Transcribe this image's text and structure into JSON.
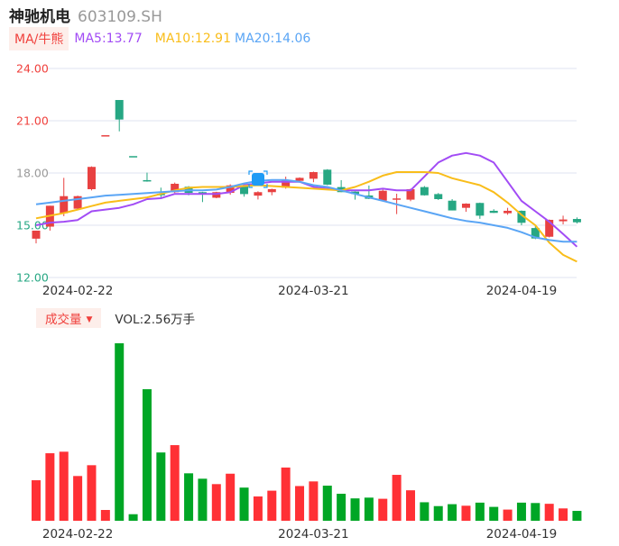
{
  "header": {
    "stock_name": "神驰机电",
    "stock_code": "603109.SH"
  },
  "ma_legend": {
    "toggle_label": "MA/牛熊",
    "ma5": "MA5:13.77",
    "ma10": "MA10:12.91",
    "ma20": "MA20:14.06"
  },
  "volume_legend": {
    "toggle_label": "成交量",
    "value": "VOL:2.56万手"
  },
  "colors": {
    "up": "#e84141",
    "down": "#26a783",
    "vol_up": "#ff3035",
    "vol_down": "#00a625",
    "ma5": "#a24cf5",
    "ma10": "#f9bd1a",
    "ma20": "#5aa5f5",
    "grid": "#dfe3f0"
  },
  "chart_data": [
    {
      "type": "candlestick",
      "title": "神驰机电 603109.SH",
      "ylim": [
        12,
        24
      ],
      "y_ticks": [
        {
          "label": "24.00",
          "value": 24,
          "color": "#f0403c"
        },
        {
          "label": "21.00",
          "value": 21,
          "color": "#f0403c"
        },
        {
          "label": "18.00",
          "value": 18,
          "color": "#999999"
        },
        {
          "label": "15.00",
          "value": 15,
          "color": "#26a783"
        },
        {
          "label": "12.00",
          "value": 12,
          "color": "#26a783"
        }
      ],
      "x_ticks": [
        {
          "label": "2024-02-22",
          "index": 3
        },
        {
          "label": "2024-03-21",
          "index": 20
        },
        {
          "label": "2024-04-19",
          "index": 35
        }
      ],
      "grid": true,
      "ohlc": [
        [
          14.23,
          14.69,
          13.96,
          14.69
        ],
        [
          14.92,
          16.12,
          14.69,
          16.12
        ],
        [
          15.69,
          17.72,
          15.52,
          16.67
        ],
        [
          15.95,
          16.7,
          15.9,
          16.67
        ],
        [
          17.07,
          18.38,
          17.0,
          18.35
        ],
        [
          20.17,
          20.17,
          20.17,
          20.17
        ],
        [
          22.19,
          22.19,
          20.39,
          21.07
        ],
        [
          18.97,
          18.97,
          18.97,
          18.97
        ],
        [
          17.59,
          18.02,
          17.5,
          17.52
        ],
        [
          16.8,
          17.16,
          16.59,
          16.72
        ],
        [
          16.9,
          17.45,
          16.85,
          17.38
        ],
        [
          17.21,
          17.25,
          16.72,
          16.86
        ],
        [
          16.9,
          16.92,
          16.33,
          16.8
        ],
        [
          16.58,
          16.92,
          16.55,
          16.9
        ],
        [
          16.86,
          17.35,
          16.75,
          17.29
        ],
        [
          17.28,
          17.3,
          16.64,
          16.79
        ],
        [
          16.7,
          16.95,
          16.48,
          16.9
        ],
        [
          16.9,
          17.1,
          16.72,
          17.07
        ],
        [
          17.16,
          17.79,
          17.1,
          17.59
        ],
        [
          17.55,
          17.75,
          17.5,
          17.72
        ],
        [
          17.67,
          18.08,
          17.47,
          18.05
        ],
        [
          18.19,
          18.22,
          17.3,
          17.33
        ],
        [
          17.19,
          17.59,
          16.9,
          16.9
        ],
        [
          16.93,
          16.95,
          16.47,
          16.8
        ],
        [
          16.71,
          17.28,
          16.5,
          16.52
        ],
        [
          16.41,
          17.1,
          16.4,
          16.98
        ],
        [
          16.54,
          16.81,
          15.64,
          16.54
        ],
        [
          16.47,
          17.1,
          16.38,
          17.07
        ],
        [
          17.19,
          17.25,
          16.7,
          16.72
        ],
        [
          16.79,
          16.85,
          16.45,
          16.5
        ],
        [
          16.41,
          16.5,
          15.85,
          15.85
        ],
        [
          16.0,
          16.26,
          15.77,
          16.24
        ],
        [
          16.28,
          16.3,
          15.37,
          15.55
        ],
        [
          15.83,
          15.92,
          15.7,
          15.71
        ],
        [
          15.69,
          16.0,
          15.6,
          15.83
        ],
        [
          15.83,
          15.85,
          15.0,
          15.14
        ],
        [
          14.84,
          14.99,
          14.2,
          14.24
        ],
        [
          14.34,
          15.33,
          14.3,
          15.31
        ],
        [
          15.23,
          15.55,
          15.05,
          15.33
        ],
        [
          15.36,
          15.45,
          15.1,
          15.17
        ]
      ],
      "series": [
        {
          "name": "MA5",
          "values": [
            15.0,
            15.15,
            15.2,
            15.3,
            15.8,
            15.9,
            16.0,
            16.2,
            16.5,
            16.55,
            16.8,
            16.8,
            16.8,
            16.8,
            16.9,
            17.3,
            17.4,
            17.5,
            17.5,
            17.5,
            17.2,
            17.1,
            17.0,
            17.0,
            17.0,
            17.1,
            17.0,
            17.0,
            17.8,
            18.6,
            19.0,
            19.15,
            19.0,
            18.6,
            17.5,
            16.4,
            15.8,
            15.2,
            14.5,
            13.77
          ]
        },
        {
          "name": "MA10",
          "values": [
            15.4,
            15.55,
            15.7,
            15.9,
            16.1,
            16.3,
            16.4,
            16.5,
            16.6,
            16.8,
            17.0,
            17.15,
            17.2,
            17.2,
            17.2,
            17.25,
            17.3,
            17.25,
            17.2,
            17.15,
            17.1,
            17.05,
            17.0,
            17.2,
            17.5,
            17.85,
            18.05,
            18.05,
            18.05,
            18.0,
            17.7,
            17.5,
            17.3,
            16.9,
            16.3,
            15.6,
            15.0,
            14.0,
            13.3,
            12.91
          ]
        },
        {
          "name": "MA20",
          "values": [
            16.2,
            16.3,
            16.4,
            16.5,
            16.6,
            16.7,
            16.75,
            16.8,
            16.85,
            16.9,
            16.95,
            17.0,
            17.0,
            17.05,
            17.2,
            17.4,
            17.55,
            17.6,
            17.6,
            17.5,
            17.3,
            17.2,
            17.0,
            16.8,
            16.6,
            16.4,
            16.2,
            16.0,
            15.8,
            15.6,
            15.4,
            15.25,
            15.15,
            15.0,
            14.85,
            14.6,
            14.3,
            14.15,
            14.06,
            14.06
          ]
        }
      ]
    },
    {
      "type": "bar",
      "title": "成交量",
      "unit": "万手",
      "ylim": [
        0,
        46
      ],
      "x_ticks": [
        {
          "label": "2024-02-22",
          "index": 3
        },
        {
          "label": "2024-03-21",
          "index": 20
        },
        {
          "label": "2024-04-19",
          "index": 35
        }
      ],
      "values": [
        10.5,
        17.5,
        17.9,
        11.6,
        14.4,
        2.8,
        46.0,
        1.7,
        34.1,
        17.7,
        19.6,
        12.3,
        10.9,
        9.5,
        12.2,
        8.6,
        6.3,
        7.8,
        13.8,
        9.0,
        10.2,
        9.1,
        7.0,
        5.8,
        6.0,
        5.7,
        11.9,
        7.9,
        4.8,
        3.8,
        4.3,
        3.9,
        4.7,
        3.6,
        2.9,
        4.7,
        4.6,
        4.4,
        3.2,
        2.56
      ]
    }
  ]
}
